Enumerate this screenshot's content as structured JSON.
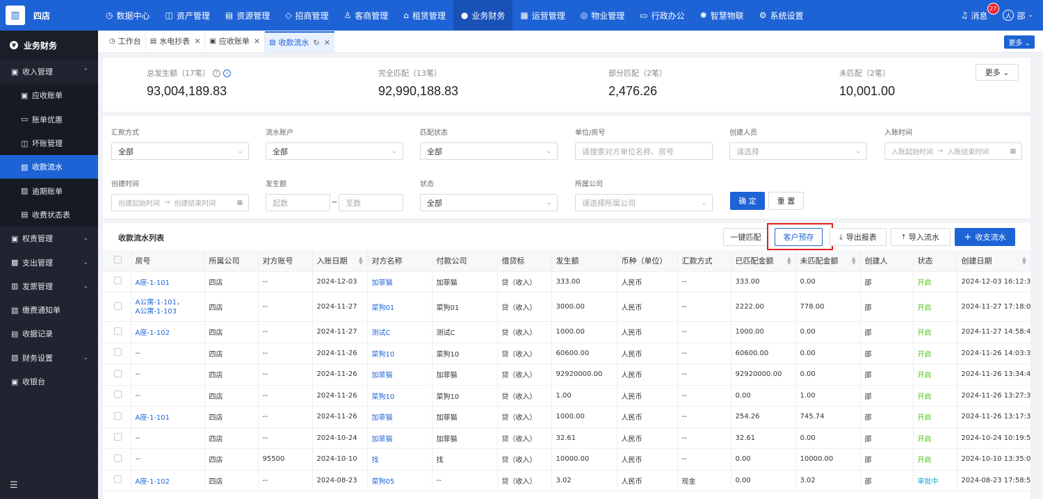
{
  "app": {
    "logo_char": "▥",
    "name": "四店"
  },
  "topnav": [
    {
      "icon": "◷",
      "label": "数据中心",
      "active": false
    },
    {
      "icon": "◫",
      "label": "资产管理",
      "active": false
    },
    {
      "icon": "▤",
      "label": "资源管理",
      "active": false
    },
    {
      "icon": "◇",
      "label": "招商管理",
      "active": false
    },
    {
      "icon": "♙",
      "label": "客商管理",
      "active": false
    },
    {
      "icon": "⌂",
      "label": "租赁管理",
      "active": false
    },
    {
      "icon": "●",
      "label": "业务财务",
      "active": true
    },
    {
      "icon": "▦",
      "label": "运营管理",
      "active": false
    },
    {
      "icon": "◎",
      "label": "物业管理",
      "active": false
    },
    {
      "icon": "▭",
      "label": "行政办公",
      "active": false
    },
    {
      "icon": "✺",
      "label": "智慧物联",
      "active": false
    },
    {
      "icon": "⚙",
      "label": "系统设置",
      "active": false
    }
  ],
  "messages": {
    "label": "消息",
    "count": "27"
  },
  "user": {
    "avatar_char": "◯",
    "name": "邵"
  },
  "sidebar": {
    "title": "业务财务",
    "items": [
      {
        "icon": "▣",
        "label": "收入管理",
        "arrow": "⌃",
        "sub": false,
        "active": false
      },
      {
        "icon": "▣",
        "label": "应收账单",
        "arrow": "",
        "sub": true,
        "active": false
      },
      {
        "icon": "▭",
        "label": "账单优惠",
        "arrow": "",
        "sub": true,
        "active": false
      },
      {
        "icon": "◫",
        "label": "坏账管理",
        "arrow": "",
        "sub": true,
        "active": false
      },
      {
        "icon": "▧",
        "label": "收款流水",
        "arrow": "",
        "sub": true,
        "active": true
      },
      {
        "icon": "▨",
        "label": "逾期账单",
        "arrow": "",
        "sub": true,
        "active": false
      },
      {
        "icon": "▤",
        "label": "收费状态表",
        "arrow": "",
        "sub": true,
        "active": false
      },
      {
        "icon": "▣",
        "label": "权责管理",
        "arrow": "⌄",
        "sub": false,
        "active": false
      },
      {
        "icon": "▩",
        "label": "支出管理",
        "arrow": "⌄",
        "sub": false,
        "active": false
      },
      {
        "icon": "▥",
        "label": "发票管理",
        "arrow": "⌄",
        "sub": false,
        "active": false
      },
      {
        "icon": "▧",
        "label": "缴费通知单",
        "arrow": "",
        "sub": false,
        "active": false
      },
      {
        "icon": "▤",
        "label": "收据记录",
        "arrow": "",
        "sub": false,
        "active": false
      },
      {
        "icon": "▧",
        "label": "财务设置",
        "arrow": "⌄",
        "sub": false,
        "active": false
      },
      {
        "icon": "▣",
        "label": "收银台",
        "arrow": "",
        "sub": false,
        "active": false
      }
    ],
    "collapse_icon": "☰"
  },
  "tabs": [
    {
      "icon": "◷",
      "label": "工作台",
      "closable": false,
      "active": false
    },
    {
      "icon": "▤",
      "label": "水电抄表",
      "closable": true,
      "active": false
    },
    {
      "icon": "▣",
      "label": "应收账单",
      "closable": true,
      "active": false
    },
    {
      "icon": "▧",
      "label": "收款流水",
      "closable": true,
      "active": true
    }
  ],
  "tabs_more": "更多 ⌄",
  "summary": {
    "total": {
      "label": "总发生额（17笔）",
      "value": "93,004,189.83"
    },
    "full": {
      "label": "完全匹配（13笔）",
      "value": "92,990,188.83"
    },
    "partial": {
      "label": "部分匹配（2笔）",
      "value": "2,476.26"
    },
    "none": {
      "label": "未匹配（2笔）",
      "value": "10,001.00"
    },
    "more": "更多 ⌄"
  },
  "filters": {
    "remit_method": {
      "label": "汇款方式",
      "value": "全部"
    },
    "flow_account": {
      "label": "流水账户",
      "value": "全部"
    },
    "match_status": {
      "label": "匹配状态",
      "value": "全部"
    },
    "unit_room": {
      "label": "单位/房号",
      "placeholder": "请搜索对方单位名称、房号"
    },
    "creator": {
      "label": "创建人员",
      "placeholder": "请选择"
    },
    "entry_time": {
      "label": "入账时间",
      "start": "入账起始时间",
      "end": "入账结束时间"
    },
    "create_time": {
      "label": "创建时间",
      "start": "创建起始时间",
      "end": "创建结束时间"
    },
    "amount": {
      "label": "发生额",
      "from": "起数",
      "sep": "~",
      "to": "至数"
    },
    "status": {
      "label": "状态",
      "value": "全部"
    },
    "company": {
      "label": "所属公司",
      "placeholder": "请选择所属公司"
    },
    "confirm": "确 定",
    "reset": "重 置"
  },
  "table": {
    "title": "收款流水列表",
    "buttons": {
      "match": "一键匹配",
      "prestore": "客户预存",
      "export": "导出报表",
      "import": "导入流水",
      "add": "收支流水"
    },
    "columns": [
      "房号",
      "所属公司",
      "对方账号",
      "入账日期",
      "对方名称",
      "付款公司",
      "借贷标",
      "发生额",
      "币种（单位）",
      "汇款方式",
      "已匹配金额",
      "未匹配金额",
      "创建人",
      "状态",
      "创建日期"
    ],
    "rows": [
      {
        "room": "A座-1-101",
        "room2": "",
        "company": "四店",
        "account": "--",
        "date": "2024-12-03",
        "name": "加菲猫",
        "payer": "加菲猫",
        "dc": "贷（收入）",
        "amount": "333.00",
        "currency": "人民币",
        "method": "--",
        "matched": "333.00",
        "unmatched": "0.00",
        "creator": "邵",
        "status": "开启",
        "status_color": "green",
        "created": "2024-12-03 16:12:31"
      },
      {
        "room": "A公寓-1-101，",
        "room2": "A公寓-1-103",
        "company": "四店",
        "account": "--",
        "date": "2024-11-27",
        "name": "菜狗01",
        "payer": "菜狗01",
        "dc": "贷（收入）",
        "amount": "3000.00",
        "currency": "人民币",
        "method": "--",
        "matched": "2222.00",
        "unmatched": "778.00",
        "creator": "邵",
        "status": "开启",
        "status_color": "green",
        "created": "2024-11-27 17:18:00"
      },
      {
        "room": "A座-1-102",
        "room2": "",
        "company": "四店",
        "account": "--",
        "date": "2024-11-27",
        "name": "测试C",
        "payer": "测试C",
        "dc": "贷（收入）",
        "amount": "1000.00",
        "currency": "人民币",
        "method": "--",
        "matched": "1000.00",
        "unmatched": "0.00",
        "creator": "邵",
        "status": "开启",
        "status_color": "green",
        "created": "2024-11-27 14:58:42"
      },
      {
        "room": "--",
        "room2": "",
        "company": "四店",
        "account": "--",
        "date": "2024-11-26",
        "name": "菜狗10",
        "payer": "菜狗10",
        "dc": "贷（收入）",
        "amount": "60600.00",
        "currency": "人民币",
        "method": "--",
        "matched": "60600.00",
        "unmatched": "0.00",
        "creator": "邵",
        "status": "开启",
        "status_color": "green",
        "created": "2024-11-26 14:03:38"
      },
      {
        "room": "--",
        "room2": "",
        "company": "四店",
        "account": "--",
        "date": "2024-11-26",
        "name": "加菲猫",
        "payer": "加菲猫",
        "dc": "贷（收入）",
        "amount": "92920000.00",
        "currency": "人民币",
        "method": "--",
        "matched": "92920000.00",
        "unmatched": "0.00",
        "creator": "邵",
        "status": "开启",
        "status_color": "green",
        "created": "2024-11-26 13:34:47"
      },
      {
        "room": "--",
        "room2": "",
        "company": "四店",
        "account": "--",
        "date": "2024-11-26",
        "name": "菜狗10",
        "payer": "菜狗10",
        "dc": "贷（收入）",
        "amount": "1.00",
        "currency": "人民币",
        "method": "--",
        "matched": "0.00",
        "unmatched": "1.00",
        "creator": "邵",
        "status": "开启",
        "status_color": "green",
        "created": "2024-11-26 13:27:30"
      },
      {
        "room": "A座-1-101",
        "room2": "",
        "company": "四店",
        "account": "--",
        "date": "2024-11-26",
        "name": "加菲猫",
        "payer": "加菲猫",
        "dc": "贷（收入）",
        "amount": "1000.00",
        "currency": "人民币",
        "method": "--",
        "matched": "254.26",
        "unmatched": "745.74",
        "creator": "邵",
        "status": "开启",
        "status_color": "green",
        "created": "2024-11-26 13:17:33"
      },
      {
        "room": "--",
        "room2": "",
        "company": "四店",
        "account": "--",
        "date": "2024-10-24",
        "name": "加菲猫",
        "payer": "加菲猫",
        "dc": "贷（收入）",
        "amount": "32.61",
        "currency": "人民币",
        "method": "--",
        "matched": "32.61",
        "unmatched": "0.00",
        "creator": "邵",
        "status": "开启",
        "status_color": "green",
        "created": "2024-10-24 10:19:59"
      },
      {
        "room": "--",
        "room2": "",
        "company": "四店",
        "account": "95500",
        "date": "2024-10-10",
        "name": "找",
        "payer": "找",
        "dc": "贷（收入）",
        "amount": "10000.00",
        "currency": "人民币",
        "method": "--",
        "matched": "0.00",
        "unmatched": "10000.00",
        "creator": "邵",
        "status": "开启",
        "status_color": "green",
        "created": "2024-10-10 13:35:09"
      },
      {
        "room": "A座-1-102",
        "room2": "",
        "company": "四店",
        "account": "--",
        "date": "2024-08-23",
        "name": "菜狗05",
        "payer": "--",
        "dc": "贷（收入）",
        "amount": "3.02",
        "currency": "人民币",
        "method": "现金",
        "matched": "0.00",
        "unmatched": "3.02",
        "creator": "邵",
        "status": "审批中",
        "status_color": "cyan",
        "created": "2024-08-23 17:58:53"
      }
    ]
  }
}
